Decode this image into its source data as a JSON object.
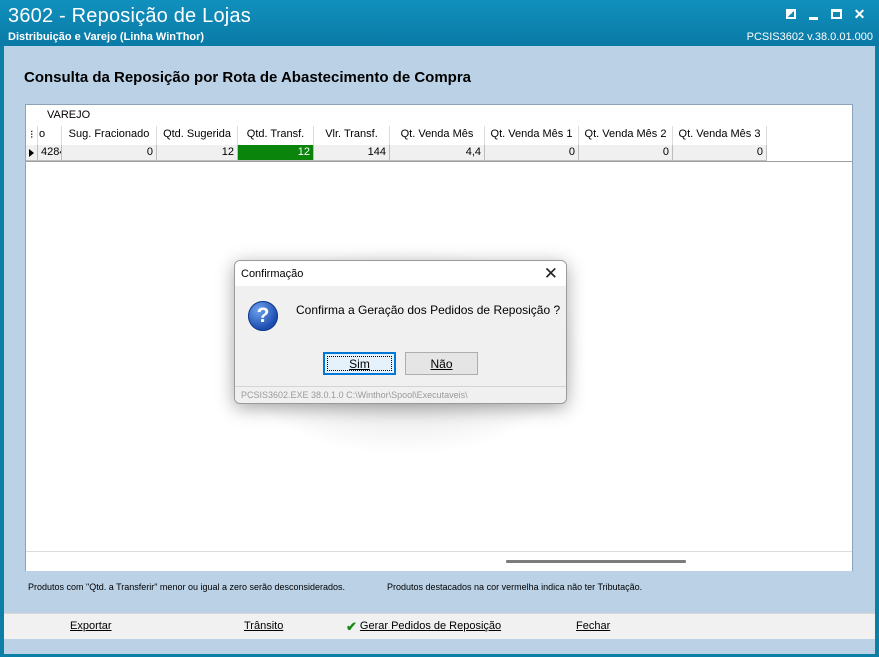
{
  "window": {
    "title": "3602 - Reposição de Lojas",
    "subtitle": "Distribuição e Varejo (Linha WinThor)",
    "version": "PCSIS3602  v.38.0.01.000",
    "buttons": [
      "restore-icon",
      "minimize-icon",
      "maximize-icon",
      "close-icon"
    ]
  },
  "page": {
    "title": "Consulta da Reposição por Rota de Abastecimento de Compra"
  },
  "grid": {
    "group_label": "VAREJO",
    "columns": [
      "",
      "o",
      "Sug. Fracionado",
      "Qtd. Sugerida",
      "Qtd. Transf.",
      "Vlr. Transf.",
      "Qt. Venda Mês",
      "Qt. Venda Mês 1",
      "Qt. Venda Mês 2",
      "Qt. Venda Mês 3"
    ],
    "rows": [
      [
        "",
        "4284",
        "0",
        "12",
        "12",
        "144",
        "4,4",
        "0",
        "0",
        "0"
      ]
    ],
    "highlight_color": "#0a840a"
  },
  "notes": {
    "left": "Produtos com \"Qtd. a Transferir\" menor ou igual a zero serão desconsiderados.",
    "right": "Produtos destacados na cor vermelha indica não ter Tributação."
  },
  "toolbar": {
    "export_label": "Exportar",
    "transit_label": "Trânsito",
    "generate_label": "Gerar Pedidos de Reposição",
    "close_label": "Fechar"
  },
  "dialog": {
    "title": "Confirmação",
    "message": "Confirma a Geração dos Pedidos de Reposição ?",
    "yes_label": "Sim",
    "no_label": "Não",
    "path": "PCSIS3602.EXE 38.0.1.0 C:\\Winthor\\Spool\\Executaveis\\",
    "icon": "question-icon"
  }
}
